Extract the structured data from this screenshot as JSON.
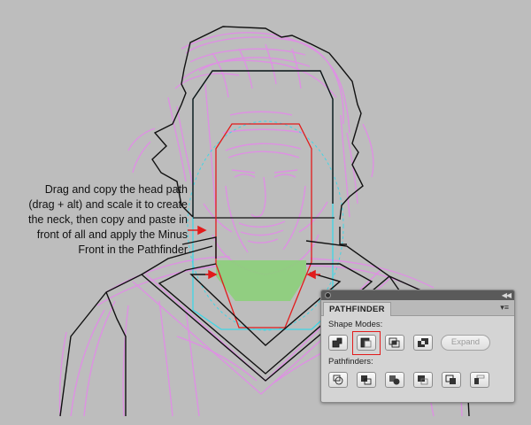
{
  "caption": {
    "lines": [
      "Drag and copy the head path",
      "(drag + alt) and scale it to create",
      "the neck, then copy and paste in",
      "front of all and apply the Minus",
      "Front in the Pathfinder"
    ]
  },
  "panel": {
    "tab_label": "PATHFINDER",
    "menu_icon": "panel-menu-icon",
    "collapse_icon": "double-chevron-icon",
    "shape_modes_label": "Shape Modes:",
    "pathfinders_label": "Pathfinders:",
    "expand_label": "Expand",
    "shape_mode_buttons": [
      "unite-icon",
      "minus-front-icon",
      "intersect-icon",
      "exclude-icon"
    ],
    "pathfinder_buttons": [
      "divide-icon",
      "trim-icon",
      "merge-icon",
      "crop-icon",
      "outline-icon",
      "minus-back-icon"
    ],
    "highlighted_button": "minus-front-icon"
  },
  "colors": {
    "canvas": "#bdbdbd",
    "sketch": "#e08ee6",
    "cyan_path": "#3fd6e6",
    "red_path": "#e21b1b",
    "neck_fill": "#8ccf7a",
    "outline": "#111111"
  }
}
